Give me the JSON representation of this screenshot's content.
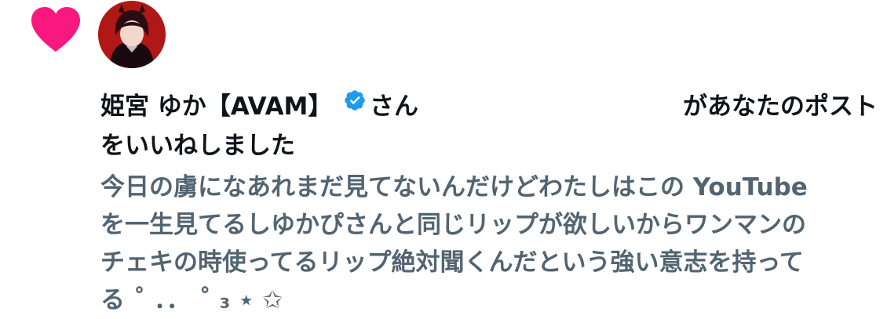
{
  "notification": {
    "user_name": "姫宮 ゆか【AVAM】",
    "suffix": "さん",
    "action_line1": "があなたのポスト",
    "action_line2": "をいいねしました"
  },
  "post": {
    "lines": [
      "今日の虜になあれまだ見てないんだけどわたしはこの YouTube",
      "を一生見てるしゆかぴさんと同じリップが欲しいからワンマンの",
      "チェキの時使ってるリップ絶対聞くんだという強い意志を持って",
      "る ˚ ．． ˚ ₃ ⋆ ✩"
    ]
  },
  "colors": {
    "heart": "#F91880",
    "verified": "#1D9BF0",
    "text_primary": "#0F1419",
    "text_secondary": "#536471"
  },
  "icons": {
    "like": "heart-icon",
    "verified": "verified-badge-icon"
  }
}
